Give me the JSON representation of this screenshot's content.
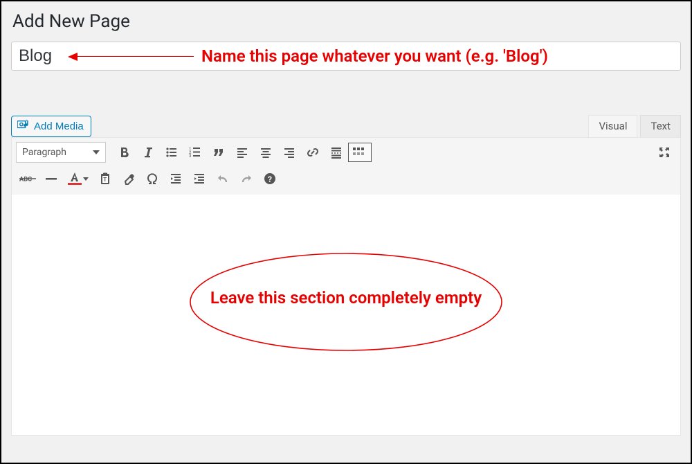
{
  "header": {
    "title": "Add New Page"
  },
  "title_field": {
    "value": "Blog"
  },
  "annotations": {
    "title_hint": "Name this page whatever you want (e.g. 'Blog')",
    "body_hint": "Leave this section completely empty"
  },
  "media_button": {
    "label": "Add Media"
  },
  "tabs": {
    "visual": "Visual",
    "text": "Text",
    "active": "visual"
  },
  "format_select": {
    "value": "Paragraph"
  },
  "toolbar_row1": [
    "bold",
    "italic",
    "bullet-list",
    "number-list",
    "blockquote",
    "align-left",
    "align-center",
    "align-right",
    "link",
    "read-more",
    "toolbar-toggle"
  ],
  "toolbar_row1_right": [
    "fullscreen"
  ],
  "toolbar_row2": [
    "strikethrough",
    "hr",
    "text-color",
    "clear-format",
    "paste-text",
    "special-char",
    "outdent",
    "indent",
    "undo",
    "redo",
    "help"
  ],
  "content": {
    "body": ""
  }
}
